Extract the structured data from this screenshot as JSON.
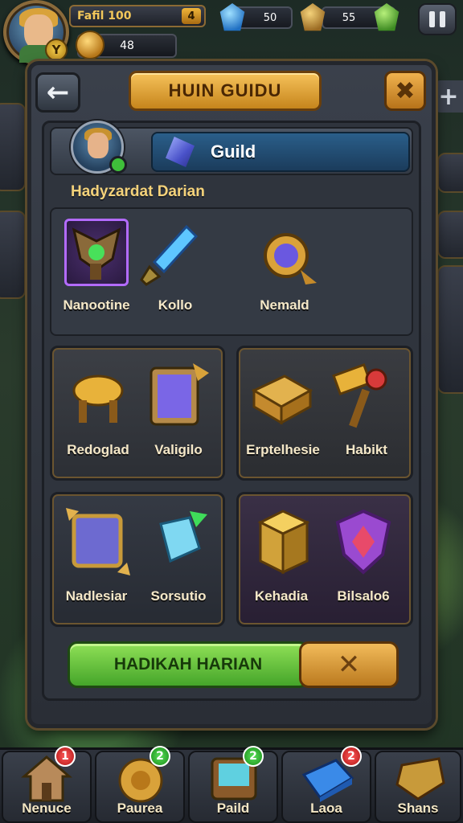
{
  "hud": {
    "player_name": "Fafil 100",
    "level": "4",
    "coins": "48",
    "resource1_value": "50",
    "resource2_value": "55"
  },
  "panel": {
    "title": "HUIN GUIDU",
    "guild_label": "Guild",
    "section_title": "Hadyzardat Darian",
    "row1_items": [
      "Nanootine",
      "Kollo",
      "Nemald"
    ],
    "card1_items": [
      "Redoglad",
      "Valigilo"
    ],
    "card2_items": [
      "Erptelhesie",
      "Habikt"
    ],
    "card3_items": [
      "Nadlesiar",
      "Sorsutio"
    ],
    "card4_items": [
      "Kehadia",
      "Bilsalo6"
    ],
    "confirm_label": "HADIKAH HARIAN",
    "cancel_symbol": "✕"
  },
  "nav": [
    {
      "label": "Nenuce",
      "badge": "1",
      "badge_color": "#d01c1c"
    },
    {
      "label": "Paurea",
      "badge": "2",
      "badge_color": "#1f9a1f"
    },
    {
      "label": "Paild",
      "badge": "2",
      "badge_color": "#1f9a1f"
    },
    {
      "label": "Laoa",
      "badge": "2",
      "badge_color": "#d01c1c"
    },
    {
      "label": "Shans",
      "badge": "",
      "badge_color": ""
    }
  ],
  "colors": {
    "accent_gold": "#f2bb5a",
    "confirm_green": "#6cc63f",
    "guild_blue": "#2a5e8a"
  },
  "icons": {
    "back": "arrow-left-icon",
    "close": "close-icon",
    "pause": "pause-icon",
    "add": "plus-icon"
  }
}
